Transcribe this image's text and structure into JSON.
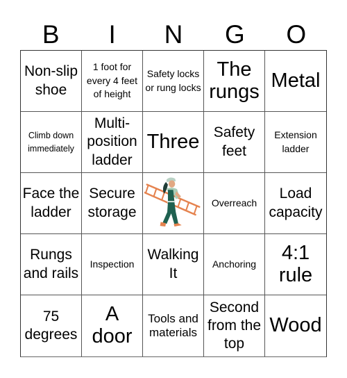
{
  "card": {
    "header_letters": [
      "B",
      "I",
      "N",
      "G",
      "O"
    ],
    "cells": [
      {
        "text": "Non-slip shoe",
        "size": "l"
      },
      {
        "text": "1 foot for every 4 feet of height",
        "size": "s"
      },
      {
        "text": "Safety locks or rung locks",
        "size": "s"
      },
      {
        "text": "The rungs",
        "size": "xl"
      },
      {
        "text": "Metal",
        "size": "xl"
      },
      {
        "text": "Climb down immediately",
        "size": "xs"
      },
      {
        "text": "Multi-position ladder",
        "size": "l"
      },
      {
        "text": "Three",
        "size": "xl"
      },
      {
        "text": "Safety feet",
        "size": "l"
      },
      {
        "text": "Extension ladder",
        "size": "s"
      },
      {
        "text": "Face the ladder",
        "size": "l"
      },
      {
        "text": "Secure storage",
        "size": "l"
      },
      {
        "text": "",
        "size": "free",
        "icon": "worker-carrying-ladder-icon"
      },
      {
        "text": "Overreach",
        "size": "s"
      },
      {
        "text": "Load capacity",
        "size": "l"
      },
      {
        "text": "Rungs and rails",
        "size": "l"
      },
      {
        "text": "Inspection",
        "size": "s"
      },
      {
        "text": "Walking It",
        "size": "l"
      },
      {
        "text": "Anchoring",
        "size": "s"
      },
      {
        "text": "4:1 rule",
        "size": "xl"
      },
      {
        "text": "75 degrees",
        "size": "l"
      },
      {
        "text": "A door",
        "size": "xl"
      },
      {
        "text": "Tools and materials",
        "size": "m"
      },
      {
        "text": "Second from the top",
        "size": "l"
      },
      {
        "text": "Wood",
        "size": "xl"
      }
    ]
  },
  "colors": {
    "ladder": "#e5834f",
    "overalls": "#1f6150",
    "shirt": "#a9cdb7",
    "skin": "#e2a883",
    "hair": "#1f3d37",
    "cap": "#b9d2c5"
  }
}
